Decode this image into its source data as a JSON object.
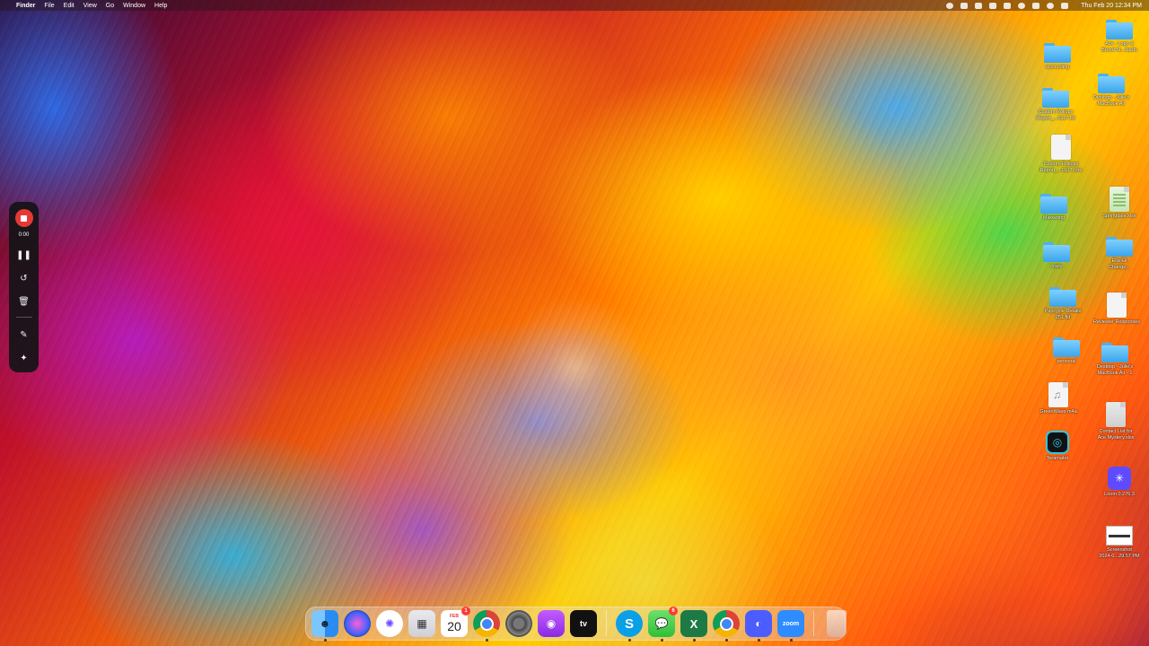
{
  "menubar": {
    "app_name": "Finder",
    "menus": [
      "File",
      "Edit",
      "View",
      "Go",
      "Window",
      "Help"
    ],
    "clock": "Thu Feb 20  12:34 PM"
  },
  "recorder": {
    "elapsed": "0:00",
    "status_color": "#e53935"
  },
  "desktop_icons": [
    {
      "label1": "Ace - Logo &",
      "label2": "Brand St...dards",
      "type": "folder"
    },
    {
      "label1": "accounting",
      "label2": "",
      "type": "folder"
    },
    {
      "label1": "Desktop - Julie's",
      "label2": "MacBook Air",
      "type": "folder"
    },
    {
      "label1": "Custom Rollups",
      "label2": "Report_...0117.fld",
      "type": "folder"
    },
    {
      "label1": "Custom Rollups",
      "label2": "Report_...0117.htm",
      "type": "document"
    },
    {
      "label1": "Marketing",
      "label2": "",
      "type": "folder"
    },
    {
      "label1": "Springdale.xlsx",
      "label2": "",
      "type": "spreadsheet"
    },
    {
      "label1": "crazy",
      "label2": "",
      "type": "folder"
    },
    {
      "label1": "Ella Eli",
      "label2": "Change...",
      "type": "folder"
    },
    {
      "label1": "Paycycle Details",
      "label2": "251.fld",
      "type": "folder"
    },
    {
      "label1": "Reviewer Responses",
      "label2": "",
      "type": "document"
    },
    {
      "label1": "personal",
      "label2": "",
      "type": "folder"
    },
    {
      "label1": "Desktop - Julie's",
      "label2": "MacBook Air - 1",
      "type": "folder"
    },
    {
      "label1": "GreenWave.m4a",
      "label2": "",
      "type": "audio"
    },
    {
      "label1": "Contact List for",
      "label2": "Ace Mystery.xlsx",
      "type": "spreadsheet"
    },
    {
      "label1": "Teramator",
      "label2": "",
      "type": "app"
    },
    {
      "label1": "Loom 0.276.3",
      "label2": "",
      "type": "app"
    },
    {
      "label1": "Screenshot",
      "label2": "2024-0...29.57 PM",
      "type": "image"
    }
  ],
  "dock": {
    "calendar_month": "FEB",
    "calendar_day": "20",
    "calendar_badge": "1",
    "messages_badge": "6",
    "appletv_label": "tv",
    "skype_label": "S",
    "excel_label": "X",
    "zoom_label": "zoom",
    "apps": [
      "Finder",
      "Siri",
      "Perplexity",
      "Launchpad",
      "Calendar",
      "Google Chrome",
      "System Settings",
      "Podcasts",
      "Apple TV",
      "Skype",
      "Messages",
      "Microsoft Excel",
      "Google Chrome",
      "OneDrive",
      "Zoom",
      "Trash"
    ]
  }
}
